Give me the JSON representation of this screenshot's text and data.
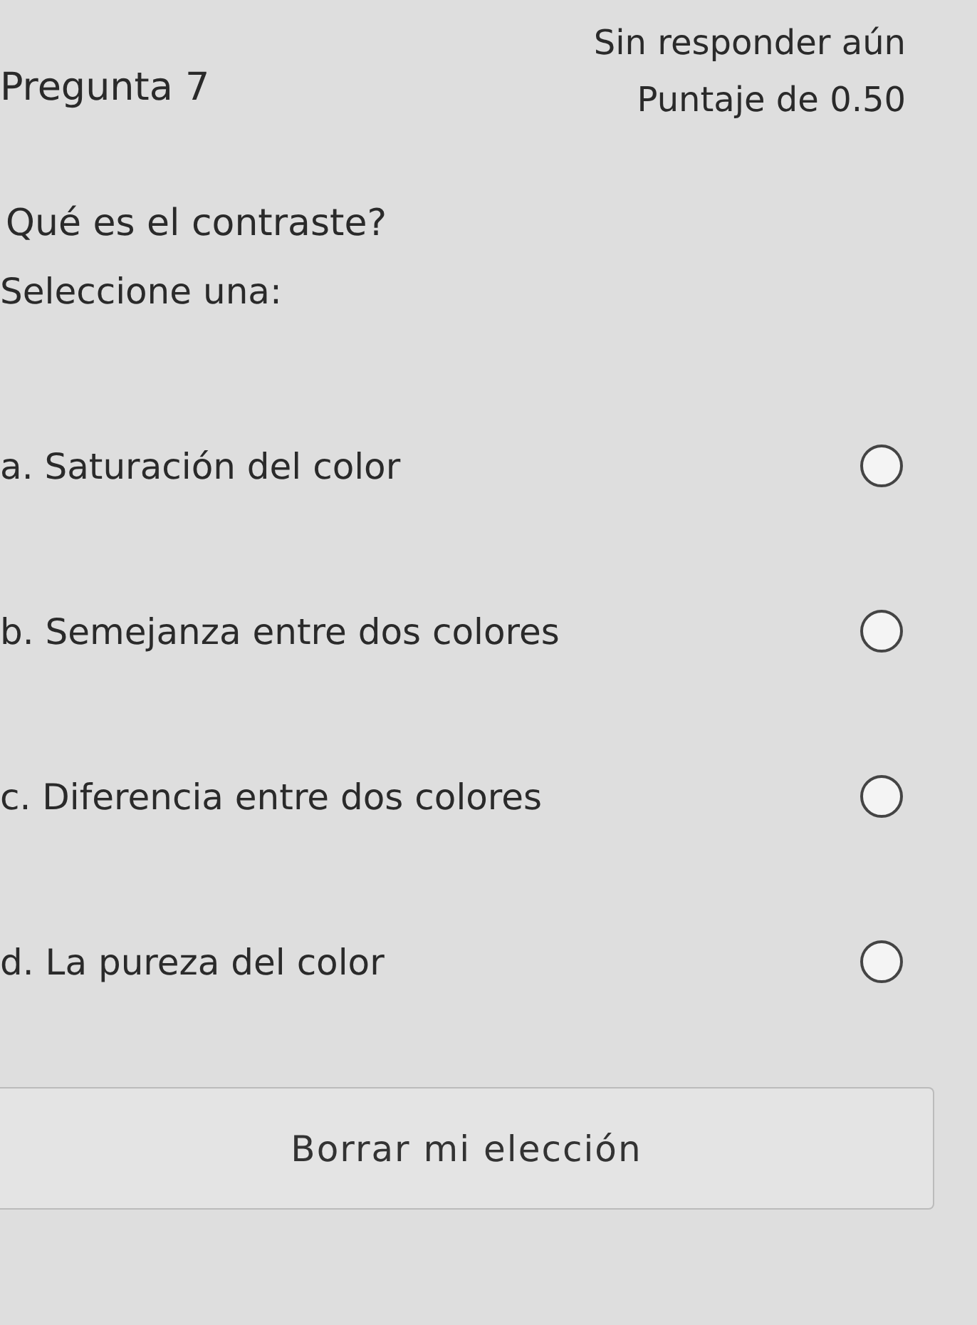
{
  "question": {
    "title": "Pregunta 7",
    "status": "Sin responder aún",
    "points": "Puntaje de 0.50"
  },
  "prompt": "Qué es el contraste?",
  "instruction": "Seleccione una:",
  "options": [
    {
      "label": "a. Saturación del color",
      "selected": false
    },
    {
      "label": "b. Semejanza entre dos colores",
      "selected": false
    },
    {
      "label": "c. Diferencia entre dos colores",
      "selected": false
    },
    {
      "label": "d. La pureza del color",
      "selected": false
    }
  ],
  "clear_button": "Borrar mi elección"
}
